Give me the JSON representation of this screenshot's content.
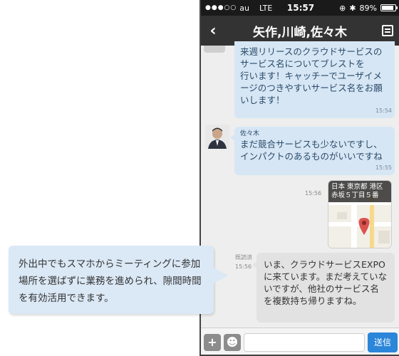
{
  "status": {
    "signal_dots": "●●●○○",
    "carrier": "au",
    "network": "LTE",
    "time": "15:57",
    "battery": "89%",
    "battery_level": 0.89
  },
  "header": {
    "back_glyph": "‹",
    "title": "矢作,川崎,佐々木"
  },
  "messages": [
    {
      "text": "来週リリースのクラウドサービスのサービス名についてブレストを\n行います！キャッチーでユーザイメージのつきやすいサービス名をお願いします！",
      "time": "15:54"
    },
    {
      "sender": "佐々木",
      "text": "まだ競合サービスも少ないですし、インパクトのあるものがいいですね",
      "time": "15:55"
    },
    {
      "time": "15:56",
      "map_label": "日本 東京都 港区 赤坂５丁目５番"
    },
    {
      "read": "既読済",
      "time": "15:56",
      "text": "いま、クラウドサービスEXPOに来ています。まだ考えていないですが、他社のサービス名を複数持ち帰りますね。"
    }
  ],
  "input": {
    "plus": "+",
    "send_label": "送信",
    "placeholder": ""
  },
  "callout": {
    "text": "外出中でもスマホからミーティングに参加場所を選ばずに業務を進められ、隙間時間を有効活用できます。"
  },
  "colors": {
    "accent": "#2b86d9",
    "bubble_blue": "#d6e6f4",
    "bubble_gray": "#e2e2e2",
    "navbar": "#333333"
  }
}
